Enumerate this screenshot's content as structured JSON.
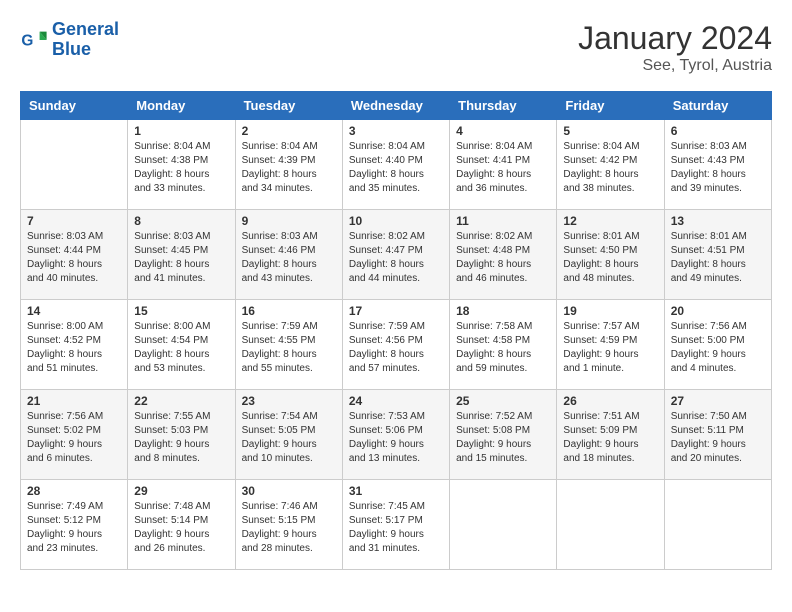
{
  "header": {
    "logo_text_general": "General",
    "logo_text_blue": "Blue",
    "title": "January 2024",
    "subtitle": "See, Tyrol, Austria"
  },
  "columns": [
    "Sunday",
    "Monday",
    "Tuesday",
    "Wednesday",
    "Thursday",
    "Friday",
    "Saturday"
  ],
  "weeks": [
    [
      {
        "day": "",
        "info": ""
      },
      {
        "day": "1",
        "info": "Sunrise: 8:04 AM\nSunset: 4:38 PM\nDaylight: 8 hours\nand 33 minutes."
      },
      {
        "day": "2",
        "info": "Sunrise: 8:04 AM\nSunset: 4:39 PM\nDaylight: 8 hours\nand 34 minutes."
      },
      {
        "day": "3",
        "info": "Sunrise: 8:04 AM\nSunset: 4:40 PM\nDaylight: 8 hours\nand 35 minutes."
      },
      {
        "day": "4",
        "info": "Sunrise: 8:04 AM\nSunset: 4:41 PM\nDaylight: 8 hours\nand 36 minutes."
      },
      {
        "day": "5",
        "info": "Sunrise: 8:04 AM\nSunset: 4:42 PM\nDaylight: 8 hours\nand 38 minutes."
      },
      {
        "day": "6",
        "info": "Sunrise: 8:03 AM\nSunset: 4:43 PM\nDaylight: 8 hours\nand 39 minutes."
      }
    ],
    [
      {
        "day": "7",
        "info": "Sunrise: 8:03 AM\nSunset: 4:44 PM\nDaylight: 8 hours\nand 40 minutes."
      },
      {
        "day": "8",
        "info": "Sunrise: 8:03 AM\nSunset: 4:45 PM\nDaylight: 8 hours\nand 41 minutes."
      },
      {
        "day": "9",
        "info": "Sunrise: 8:03 AM\nSunset: 4:46 PM\nDaylight: 8 hours\nand 43 minutes."
      },
      {
        "day": "10",
        "info": "Sunrise: 8:02 AM\nSunset: 4:47 PM\nDaylight: 8 hours\nand 44 minutes."
      },
      {
        "day": "11",
        "info": "Sunrise: 8:02 AM\nSunset: 4:48 PM\nDaylight: 8 hours\nand 46 minutes."
      },
      {
        "day": "12",
        "info": "Sunrise: 8:01 AM\nSunset: 4:50 PM\nDaylight: 8 hours\nand 48 minutes."
      },
      {
        "day": "13",
        "info": "Sunrise: 8:01 AM\nSunset: 4:51 PM\nDaylight: 8 hours\nand 49 minutes."
      }
    ],
    [
      {
        "day": "14",
        "info": "Sunrise: 8:00 AM\nSunset: 4:52 PM\nDaylight: 8 hours\nand 51 minutes."
      },
      {
        "day": "15",
        "info": "Sunrise: 8:00 AM\nSunset: 4:54 PM\nDaylight: 8 hours\nand 53 minutes."
      },
      {
        "day": "16",
        "info": "Sunrise: 7:59 AM\nSunset: 4:55 PM\nDaylight: 8 hours\nand 55 minutes."
      },
      {
        "day": "17",
        "info": "Sunrise: 7:59 AM\nSunset: 4:56 PM\nDaylight: 8 hours\nand 57 minutes."
      },
      {
        "day": "18",
        "info": "Sunrise: 7:58 AM\nSunset: 4:58 PM\nDaylight: 8 hours\nand 59 minutes."
      },
      {
        "day": "19",
        "info": "Sunrise: 7:57 AM\nSunset: 4:59 PM\nDaylight: 9 hours\nand 1 minute."
      },
      {
        "day": "20",
        "info": "Sunrise: 7:56 AM\nSunset: 5:00 PM\nDaylight: 9 hours\nand 4 minutes."
      }
    ],
    [
      {
        "day": "21",
        "info": "Sunrise: 7:56 AM\nSunset: 5:02 PM\nDaylight: 9 hours\nand 6 minutes."
      },
      {
        "day": "22",
        "info": "Sunrise: 7:55 AM\nSunset: 5:03 PM\nDaylight: 9 hours\nand 8 minutes."
      },
      {
        "day": "23",
        "info": "Sunrise: 7:54 AM\nSunset: 5:05 PM\nDaylight: 9 hours\nand 10 minutes."
      },
      {
        "day": "24",
        "info": "Sunrise: 7:53 AM\nSunset: 5:06 PM\nDaylight: 9 hours\nand 13 minutes."
      },
      {
        "day": "25",
        "info": "Sunrise: 7:52 AM\nSunset: 5:08 PM\nDaylight: 9 hours\nand 15 minutes."
      },
      {
        "day": "26",
        "info": "Sunrise: 7:51 AM\nSunset: 5:09 PM\nDaylight: 9 hours\nand 18 minutes."
      },
      {
        "day": "27",
        "info": "Sunrise: 7:50 AM\nSunset: 5:11 PM\nDaylight: 9 hours\nand 20 minutes."
      }
    ],
    [
      {
        "day": "28",
        "info": "Sunrise: 7:49 AM\nSunset: 5:12 PM\nDaylight: 9 hours\nand 23 minutes."
      },
      {
        "day": "29",
        "info": "Sunrise: 7:48 AM\nSunset: 5:14 PM\nDaylight: 9 hours\nand 26 minutes."
      },
      {
        "day": "30",
        "info": "Sunrise: 7:46 AM\nSunset: 5:15 PM\nDaylight: 9 hours\nand 28 minutes."
      },
      {
        "day": "31",
        "info": "Sunrise: 7:45 AM\nSunset: 5:17 PM\nDaylight: 9 hours\nand 31 minutes."
      },
      {
        "day": "",
        "info": ""
      },
      {
        "day": "",
        "info": ""
      },
      {
        "day": "",
        "info": ""
      }
    ]
  ]
}
